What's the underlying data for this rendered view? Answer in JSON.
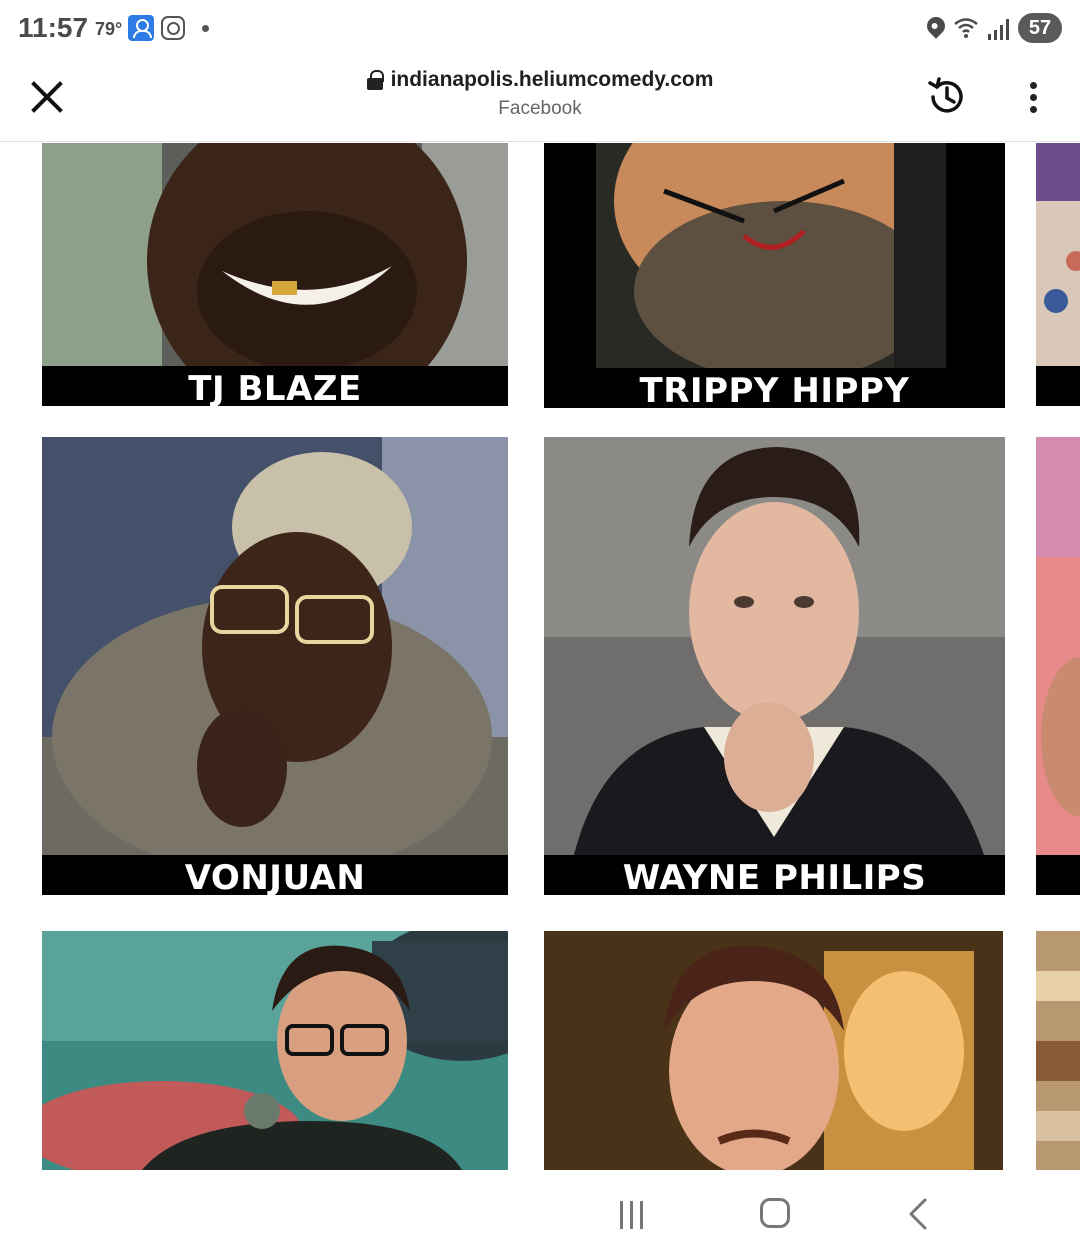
{
  "status_bar": {
    "time": "11:57",
    "temperature": "79°",
    "battery": "57"
  },
  "browser": {
    "url": "indianapolis.heliumcomedy.com",
    "source": "Facebook"
  },
  "comedians": [
    {
      "name": "TJ BLAZE",
      "photo": "comedian-photo"
    },
    {
      "name": "TRIPPY HIPPY",
      "photo": "comedian-photo"
    },
    {
      "name": "VONJUAN",
      "photo": "comedian-photo"
    },
    {
      "name": "WAYNE PHILIPS",
      "photo": "comedian-photo"
    },
    {
      "name": "",
      "photo": "comedian-photo"
    },
    {
      "name": "",
      "photo": "comedian-photo"
    }
  ],
  "colors": {
    "name_plate_bg": "#000000",
    "name_plate_text": "#ffffff",
    "battery_badge": "#5a5a5a"
  }
}
